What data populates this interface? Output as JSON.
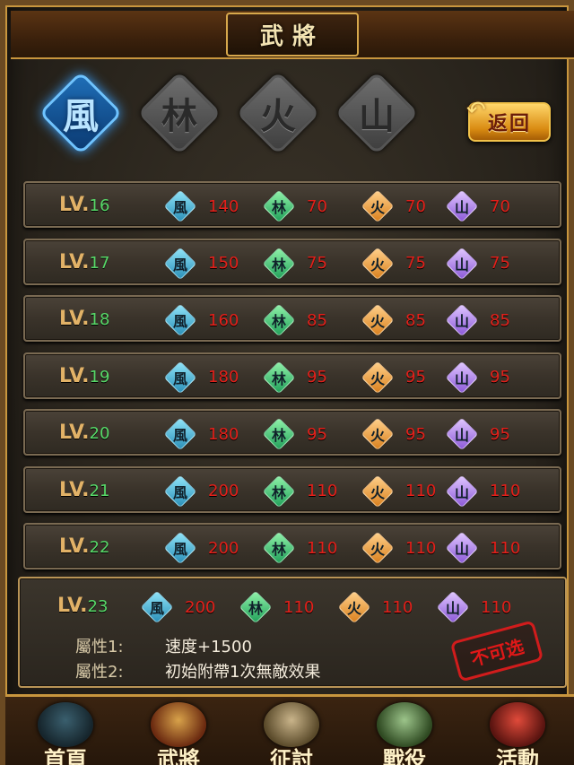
{
  "header": {
    "title": "武將"
  },
  "tabs": [
    {
      "glyph": "風",
      "active": true
    },
    {
      "glyph": "林",
      "active": false
    },
    {
      "glyph": "火",
      "active": false
    },
    {
      "glyph": "山",
      "active": false
    }
  ],
  "back_button": {
    "label": "返回"
  },
  "elements": {
    "wind": "風",
    "forest": "林",
    "fire": "火",
    "mountain": "山"
  },
  "rows": [
    {
      "lv_prefix": "LV.",
      "level": "16",
      "wind": "140",
      "forest": "70",
      "fire": "70",
      "mountain": "70"
    },
    {
      "lv_prefix": "LV.",
      "level": "17",
      "wind": "150",
      "forest": "75",
      "fire": "75",
      "mountain": "75"
    },
    {
      "lv_prefix": "LV.",
      "level": "18",
      "wind": "160",
      "forest": "85",
      "fire": "85",
      "mountain": "85"
    },
    {
      "lv_prefix": "LV.",
      "level": "19",
      "wind": "180",
      "forest": "95",
      "fire": "95",
      "mountain": "95"
    },
    {
      "lv_prefix": "LV.",
      "level": "20",
      "wind": "180",
      "forest": "95",
      "fire": "95",
      "mountain": "95"
    },
    {
      "lv_prefix": "LV.",
      "level": "21",
      "wind": "200",
      "forest": "110",
      "fire": "110",
      "mountain": "110"
    },
    {
      "lv_prefix": "LV.",
      "level": "22",
      "wind": "200",
      "forest": "110",
      "fire": "110",
      "mountain": "110"
    }
  ],
  "detail": {
    "lv_prefix": "LV.",
    "level": "23",
    "wind": "200",
    "forest": "110",
    "fire": "110",
    "mountain": "110",
    "attr1_label": "屬性1:",
    "attr1_value": "速度+1500",
    "attr2_label": "屬性2:",
    "attr2_value": "初始附帶1次無敵效果",
    "stamp": "不可选"
  },
  "nav": [
    {
      "label": "首頁"
    },
    {
      "label": "武將"
    },
    {
      "label": "征討"
    },
    {
      "label": "戰役"
    },
    {
      "label": "活動"
    }
  ]
}
